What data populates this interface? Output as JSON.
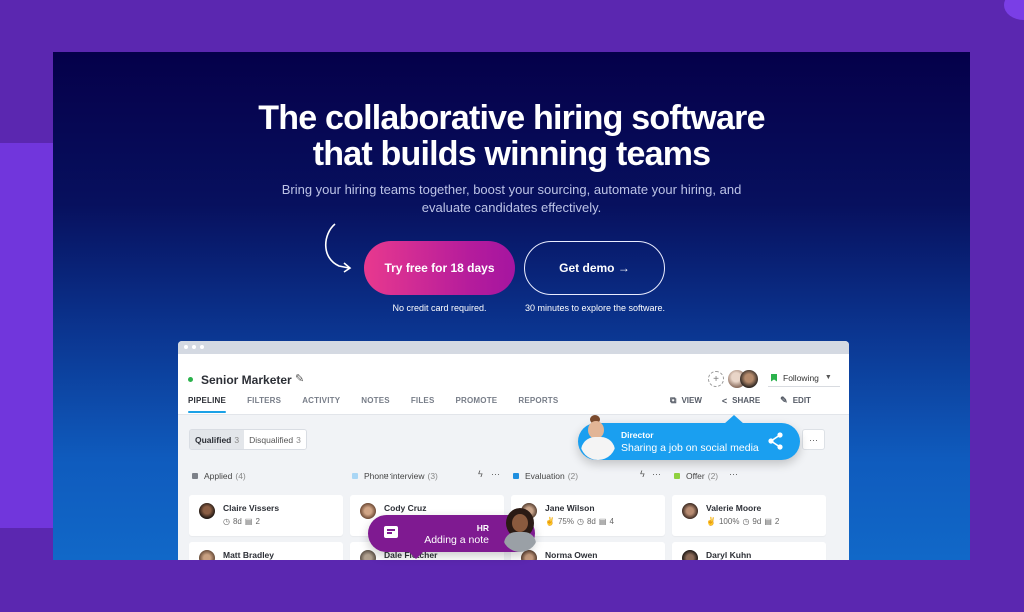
{
  "hero": {
    "title_line1": "The collaborative hiring software",
    "title_line2": "that builds winning teams",
    "subtitle_line1": "Bring your hiring teams together, boost your sourcing, automate your hiring, and",
    "subtitle_line2": "evaluate candidates effectively.",
    "primary_cta": "Try free for 18 days",
    "primary_note": "No credit card required.",
    "secondary_cta": "Get demo →",
    "secondary_note": "30 minutes to explore the software."
  },
  "app": {
    "job_title": "Senior Marketer",
    "tabs": [
      "PIPELINE",
      "FILTERS",
      "ACTIVITY",
      "NOTES",
      "FILES",
      "PROMOTE",
      "REPORTS"
    ],
    "active_tab": "PIPELINE",
    "following_label": "Following",
    "actions": {
      "view": "VIEW",
      "share": "SHARE",
      "edit": "EDIT"
    },
    "segment": {
      "qualified_label": "Qualified",
      "qualified_count": "3",
      "disqualified_label": "Disqualified",
      "disqualified_count": "3"
    },
    "more_label": "···",
    "columns": [
      {
        "label": "Applied",
        "count": "(4)",
        "color": "#7d8189"
      },
      {
        "label": "Phone interview",
        "count": "(3)",
        "color": "#a9d6f5"
      },
      {
        "label": "Evaluation",
        "count": "(2)",
        "color": "#1f8fdf"
      },
      {
        "label": "Offer",
        "count": "(2)",
        "color": "#8fd13f"
      }
    ],
    "cards": [
      {
        "name": "Claire Vissers",
        "days": "8d",
        "comments": "2"
      },
      {
        "name": "Cody Cruz"
      },
      {
        "name": "Jane Wilson",
        "score": "75%",
        "days": "8d",
        "comments": "4"
      },
      {
        "name": "Valerie Moore",
        "score": "100%",
        "days": "9d",
        "comments": "2"
      },
      {
        "name": "Matt Bradley"
      },
      {
        "name": "Dale Fletcher"
      },
      {
        "name": "Norma Owen"
      },
      {
        "name": "Daryl Kuhn"
      }
    ]
  },
  "bubbles": {
    "director": {
      "role": "Director",
      "action": "Sharing a job on social media"
    },
    "hr": {
      "role": "HR",
      "action": "Adding a note"
    }
  },
  "colors": {
    "brand_purple": "#5b27b0",
    "accent_blue": "#1a9ff0",
    "cta_pink": "#e8398e",
    "hr_purple": "#7f1a91",
    "status_green": "#2bb24c"
  }
}
